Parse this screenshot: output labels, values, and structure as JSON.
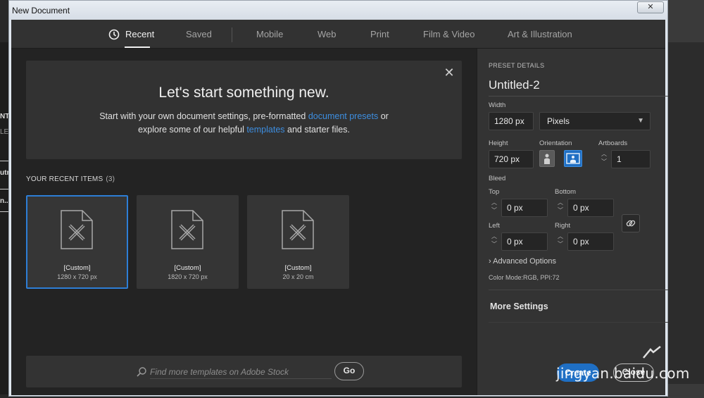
{
  "window": {
    "title": "New Document"
  },
  "tabs": [
    {
      "label": "Recent",
      "active": true
    },
    {
      "label": "Saved"
    },
    {
      "label": "Mobile"
    },
    {
      "label": "Web"
    },
    {
      "label": "Print"
    },
    {
      "label": "Film & Video"
    },
    {
      "label": "Art & Illustration"
    }
  ],
  "welcome": {
    "title": "Let's start something new.",
    "line1_before": "Start with your own document settings, pre-formatted ",
    "line1_link": "document presets",
    "line1_after": " or",
    "line2_before": "explore some of our helpful ",
    "line2_link": "templates",
    "line2_after": " and starter files."
  },
  "recent": {
    "heading": "YOUR RECENT ITEMS",
    "count": "(3)",
    "items": [
      {
        "name": "[Custom]",
        "size": "1280 x 720 px"
      },
      {
        "name": "[Custom]",
        "size": "1820 x 720 px"
      },
      {
        "name": "[Custom]",
        "size": "20 x 20 cm"
      }
    ]
  },
  "search": {
    "placeholder": "Find more templates on Adobe Stock",
    "go_label": "Go"
  },
  "preset": {
    "heading": "PRESET DETAILS",
    "name": "Untitled-2",
    "width_label": "Width",
    "width_value": "1280 px",
    "units": "Pixels",
    "height_label": "Height",
    "height_value": "720 px",
    "orientation_label": "Orientation",
    "artboards_label": "Artboards",
    "artboards_value": "1",
    "bleed_label": "Bleed",
    "top_label": "Top",
    "top_value": "0 px",
    "bottom_label": "Bottom",
    "bottom_value": "0 px",
    "left_label": "Left",
    "left_value": "0 px",
    "right_label": "Right",
    "right_value": "0 px",
    "advanced_label": "Advanced Options",
    "color_mode": "Color Mode:RGB, PPI:72",
    "more_settings": "More Settings"
  },
  "actions": {
    "create": "Create",
    "close": "Close"
  },
  "watermark": {
    "text": "jingyan.baidu.com"
  },
  "colors": {
    "accent": "#1f6fc4",
    "link": "#3d8ee0",
    "panel": "#333333",
    "dialog": "#232323"
  },
  "background_fragments": [
    "NT",
    "LE",
    "utra",
    "n.."
  ]
}
